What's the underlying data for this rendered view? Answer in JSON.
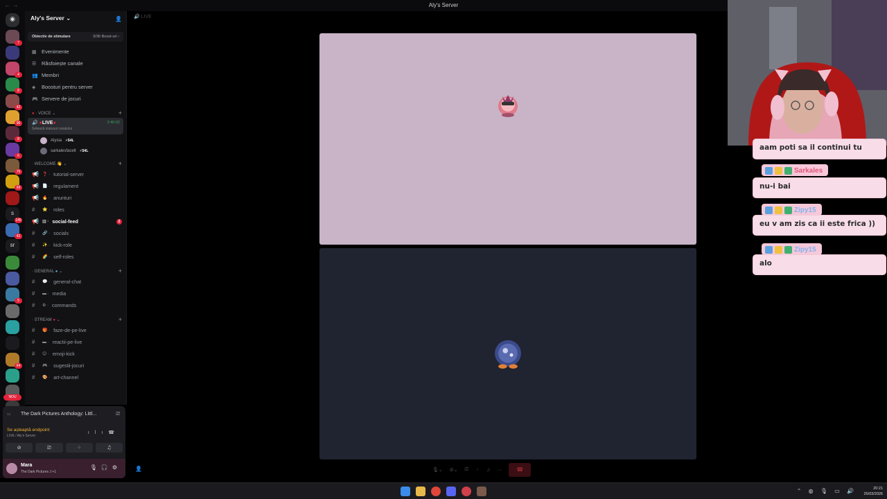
{
  "window": {
    "title": "Aly's Server",
    "nav": "← →"
  },
  "server": {
    "name": "Aly's Server",
    "boost_goal": "Obiectiv de stimulare",
    "boost_count": "0/36 Boost-uri"
  },
  "menu": [
    {
      "label": "Evenimente",
      "icon": "calendar-icon"
    },
    {
      "label": "Răsfoiește canale",
      "icon": "browse-icon"
    },
    {
      "label": "Membri",
      "icon": "members-icon"
    },
    {
      "label": "Boosturi pentru server",
      "icon": "boost-icon"
    },
    {
      "label": "Servere de jocuri",
      "icon": "gamepad-icon"
    }
  ],
  "voice": {
    "category": "VOICE",
    "channel": "LIVE",
    "status": "Setează statusul canalului",
    "time": "2:40:02",
    "users": [
      {
        "name": "Alysia",
        "tag": "S4L"
      },
      {
        "name": "sarkalesfacelt",
        "tag": "S4L"
      }
    ]
  },
  "welcome": {
    "category": "WELCOME",
    "channels": [
      {
        "name": "tutorial-server",
        "type": "announce",
        "emoji": "❓"
      },
      {
        "name": "regulament",
        "type": "announce",
        "emoji": "📄"
      },
      {
        "name": "anunturi",
        "type": "announce",
        "emoji": "🔥"
      },
      {
        "name": "roles",
        "type": "text",
        "emoji": "⭐"
      },
      {
        "name": "social-feed",
        "type": "announce",
        "emoji": "▥",
        "active": true,
        "badge": "2"
      },
      {
        "name": "socials",
        "type": "text",
        "emoji": "🔗"
      },
      {
        "name": "kick-role",
        "type": "text",
        "emoji": "✨"
      },
      {
        "name": "self-roles",
        "type": "text",
        "emoji": "🌈"
      }
    ]
  },
  "general": {
    "category": "GENERAL",
    "channels": [
      {
        "name": "general-chat",
        "emoji": "💬"
      },
      {
        "name": "media",
        "emoji": "▬"
      },
      {
        "name": "commands",
        "emoji": "⚙"
      }
    ]
  },
  "stream": {
    "category": "STREAM",
    "channels": [
      {
        "name": "faze-de-pe-live",
        "emoji": "🎁"
      },
      {
        "name": "reactii-pe-live",
        "emoji": "▬"
      },
      {
        "name": "emoji-kick",
        "emoji": "😊"
      },
      {
        "name": "sugestii-jocuri",
        "emoji": "🎮"
      },
      {
        "name": "art-channel",
        "emoji": "🎨"
      }
    ]
  },
  "guild_badges": [
    "7",
    "",
    "4",
    "8",
    "42",
    "96",
    "8",
    "6",
    "76",
    "69",
    "",
    "145",
    "42",
    "",
    "",
    "",
    "5",
    "",
    "",
    "",
    "64",
    "",
    "",
    ""
  ],
  "nou_label": "NOU",
  "panel": {
    "activity": "The Dark Pictures Anthology: Littl...",
    "vc_status": "Se așteaptă endpoint",
    "vc_sub": "LIVE / Aly's Server",
    "user_name": "Mara",
    "user_activity": "The Dark Pictures J +1"
  },
  "stage": {
    "header": "LIVE"
  },
  "chat": [
    {
      "name": "",
      "text": "aam poti sa il continui tu"
    },
    {
      "name": "Sarkales",
      "name_color": "#e0567a",
      "text": "nu-i bai"
    },
    {
      "name": "Zipy15",
      "name_color": "#7fb4f0",
      "text": "eu v am zis ca ii este frica ))"
    },
    {
      "name": "Zipy15",
      "name_color": "#7fb4f0",
      "text": "alo"
    }
  ],
  "taskbar": {
    "time": "20:21",
    "date": "25/03/2026"
  }
}
